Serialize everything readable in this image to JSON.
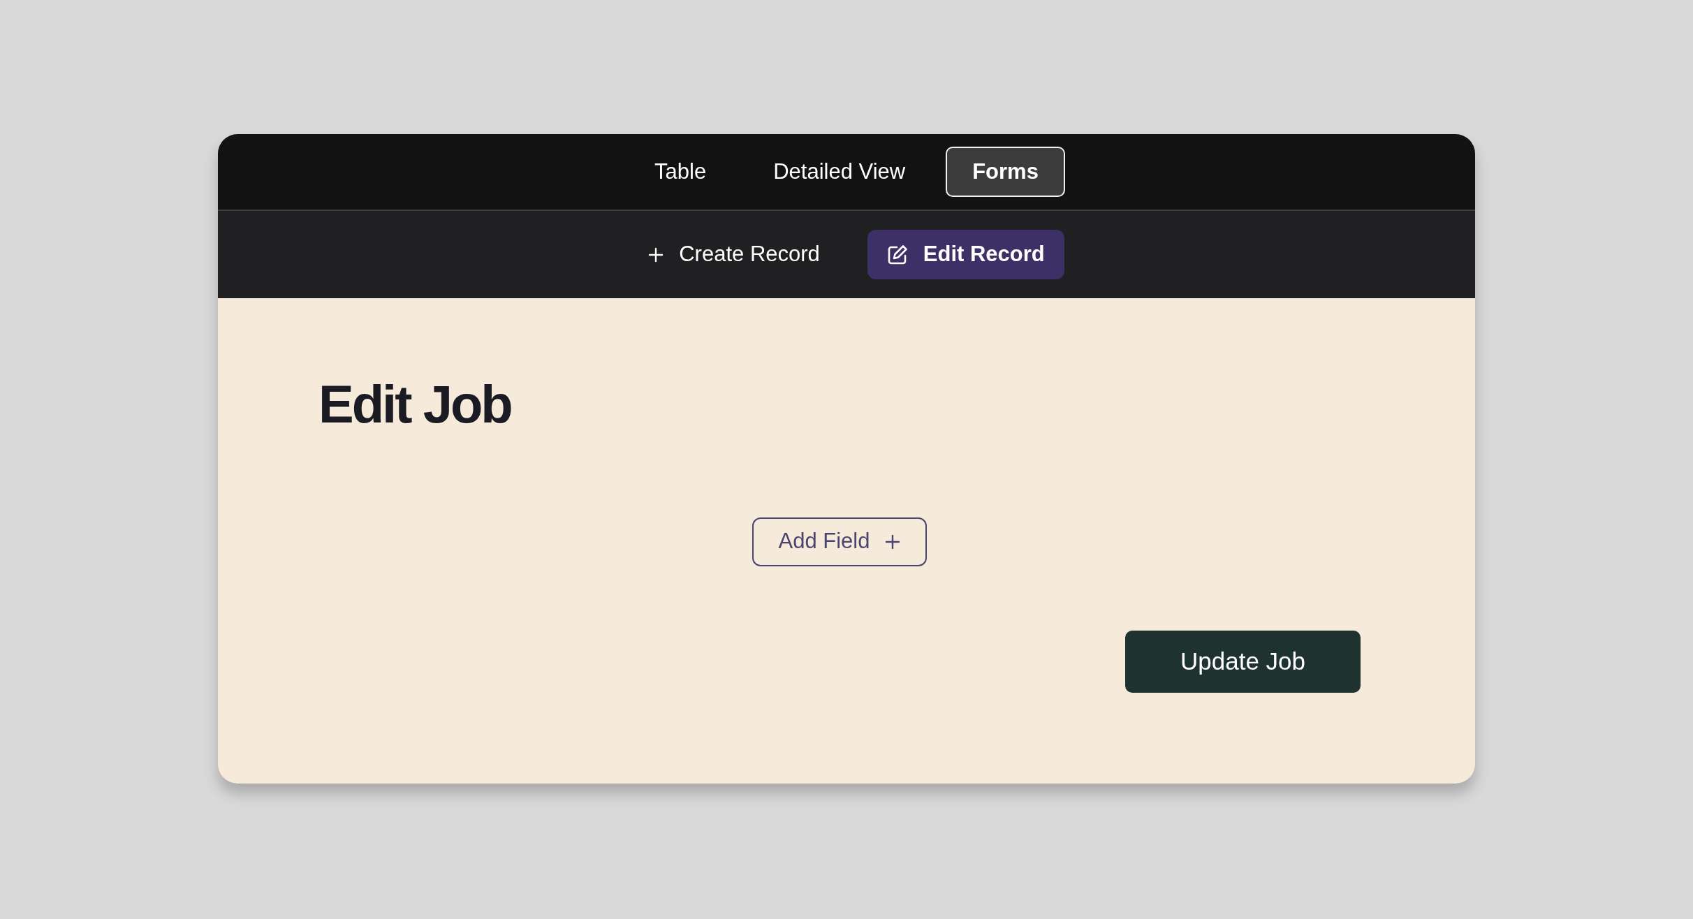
{
  "tabs": [
    {
      "label": "Table",
      "selected": false
    },
    {
      "label": "Detailed View",
      "selected": false
    },
    {
      "label": "Forms",
      "selected": true
    }
  ],
  "actions": [
    {
      "label": "Create Record",
      "kind": "create",
      "selected": false
    },
    {
      "label": "Edit Record",
      "kind": "edit",
      "selected": true
    }
  ],
  "form": {
    "title": "Edit Job",
    "add_field_button": "Add Field",
    "submit_button": "Update Job"
  }
}
